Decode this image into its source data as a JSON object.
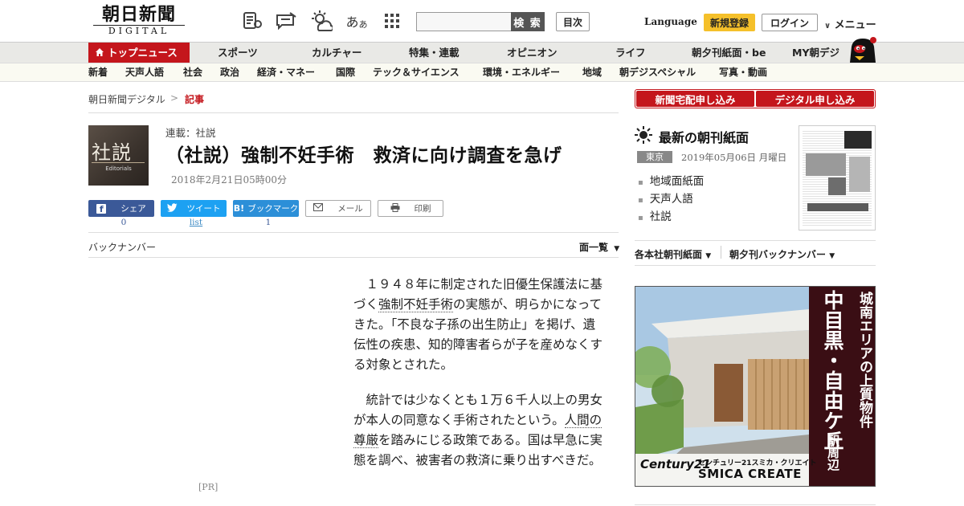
{
  "brand": {
    "logo_kanji": "朝日新聞",
    "logo_sub": "DIGITAL"
  },
  "header": {
    "search_placeholder": "",
    "search_button": "検 索",
    "toc_button": "目次",
    "language": "Language",
    "register": "新規登録",
    "login": "ログイン",
    "menu": "メニュー",
    "icons": [
      "news-reader-icon",
      "message-icon",
      "weather-icon",
      "font-size-icon",
      "apps-grid-icon"
    ],
    "font_size_glyph": "あ"
  },
  "main_nav": [
    "トップニュース",
    "スポーツ",
    "カルチャー",
    "特集・連載",
    "オピニオン",
    "ライフ",
    "朝夕刊紙面・be",
    "MY朝デジ"
  ],
  "sub_nav": [
    "新着",
    "天声人語",
    "社会",
    "政治",
    "経済・マネー",
    "国際",
    "テック＆サイエンス",
    "環境・エネルギー",
    "地域",
    "朝デジスペシャル",
    "写真・動画"
  ],
  "breadcrumb": {
    "home": "朝日新聞デジタル",
    "separator": ">",
    "current": "記事"
  },
  "article": {
    "logo_text": "社説",
    "logo_sub": "Editorials",
    "series": "連載：社説",
    "headline": "（社説）強制不妊手術　救済に向け調査を急げ",
    "date": "2018年2月21日05時00分",
    "share": {
      "facebook": "シェア",
      "facebook_count": "0",
      "twitter": "ツイート",
      "twitter_count": "list",
      "hatena_mark": "B!",
      "hatena": "ブックマーク",
      "hatena_count": "1",
      "mail": "メール",
      "print": "印刷"
    },
    "backnumber": "バックナンバー",
    "menu_list": "面一覧",
    "pr": "[PR]",
    "paragraphs": [
      {
        "pre": "１９４８年に制定された旧優生保護法に基づく",
        "kw": "強制不妊手術",
        "post": "の実態が、明らかになってきた。「不良な子孫の出生防止」を掲げ、遺伝性の疾患、知的障害者らが子を産めなくする対象とされた。"
      },
      {
        "pre": "統計では少なくとも１万６千人以上の男女が本人の同意なく手術されたという。",
        "kw": "人間の尊厳",
        "post": "を踏みにじる政策である。国は早急に実態を調べ、被害者の救済に乗り出すべきだ。"
      }
    ]
  },
  "sidebar": {
    "apply_home": "新聞宅配申し込み",
    "apply_digital": "デジタル申し込み",
    "latest_title": "最新の朝刊紙面",
    "region": "東京",
    "edition_date": "2019年05月06日 月曜日",
    "links": [
      "地域面紙面",
      "天声人語",
      "社説"
    ],
    "edition_menu_1": "各本社朝刊紙面",
    "edition_menu_2": "朝夕刊バックナンバー",
    "ad": {
      "headline_small": "城南エリアの上質物件",
      "headline_big": "中目黒・自由ケ丘",
      "headline_tail": "駅周辺",
      "brand_logo": "Century21",
      "company_jp": "センチュリー21スミカ・クリエイト",
      "company_en": "SMICA CREATE"
    }
  },
  "colors": {
    "accent": "#c4161c",
    "register": "#f5c02a",
    "facebook": "#3b5998",
    "twitter": "#1da1f2",
    "hatena": "#2c8fd8"
  }
}
